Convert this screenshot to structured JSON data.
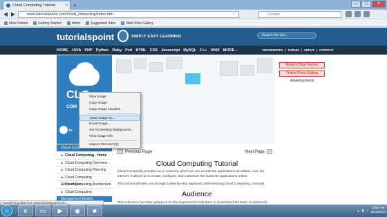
{
  "browser": {
    "tab_title": "Cloud Computing Tutorial",
    "url": "www.tutorialspoint.com/cloud_computing/index.htm",
    "search_placeholder": "Google",
    "bookmarks": [
      "Most Visited",
      "Getting Started",
      "dhtml",
      "Suggested Sites",
      "Web Slice Gallery"
    ],
    "status_text": "Transferring data from www.tutorialspoint.com..."
  },
  "site": {
    "logo": "tutorialspoint",
    "tagline": "SIMPLY EASY LEARNING",
    "search_placeholder": "Search the site...",
    "menu": [
      "HOME",
      "JAVA",
      "PHP",
      "Python",
      "Ruby",
      "Perl",
      "HTML",
      "CSS",
      "Javascript",
      "MySQL",
      "C++",
      "UNIX",
      "MORE..."
    ],
    "right_menu": [
      "REFERENCES",
      "FORUM",
      "ABOUT",
      "CONTACT"
    ]
  },
  "sidebar": {
    "banner_title": "CLO",
    "banner_subtitle": "COM",
    "mini_logo": "tu",
    "header": "Cloud Computing Tutorial",
    "items": [
      "Cloud Computing - Home",
      "Cloud Computing Overview",
      "Cloud Computing Planning",
      "Cloud Computing Technologies",
      "Cloud Computing Architecture",
      "Cloud Computing Infrastructure"
    ],
    "bottom_header": "Management Models"
  },
  "right_column": {
    "buttons": [
      "Modern Baby Names",
      "Online Photo Editing"
    ],
    "ads_label": "Advertisements"
  },
  "context_menu": {
    "items": [
      "View Image",
      "Copy Image",
      "Copy Image Location",
      "Save Image As...",
      "Email Image...",
      "Set As Desktop Background...",
      "View Image Info",
      "Inspect Element (Q)"
    ],
    "highlighted_index": 3
  },
  "content": {
    "prev": "Previous Page",
    "next": "Next Page",
    "title": "Cloud Computing Tutorial",
    "para1": "Cloud Computing provides us a means by which we can access the applications as utilities, over the internet. It allows us to create, configure, and customize the business applications online.",
    "para2": "This tutorial will take you through a step-by-step approach while learning Cloud Computing concepts.",
    "section": "Audience",
    "para3": "This reference has been prepared for the beginners to help them to understand the basic-to-advanced"
  },
  "taskbar": {
    "time": "3:54 PM",
    "date": "6/18/2014"
  }
}
